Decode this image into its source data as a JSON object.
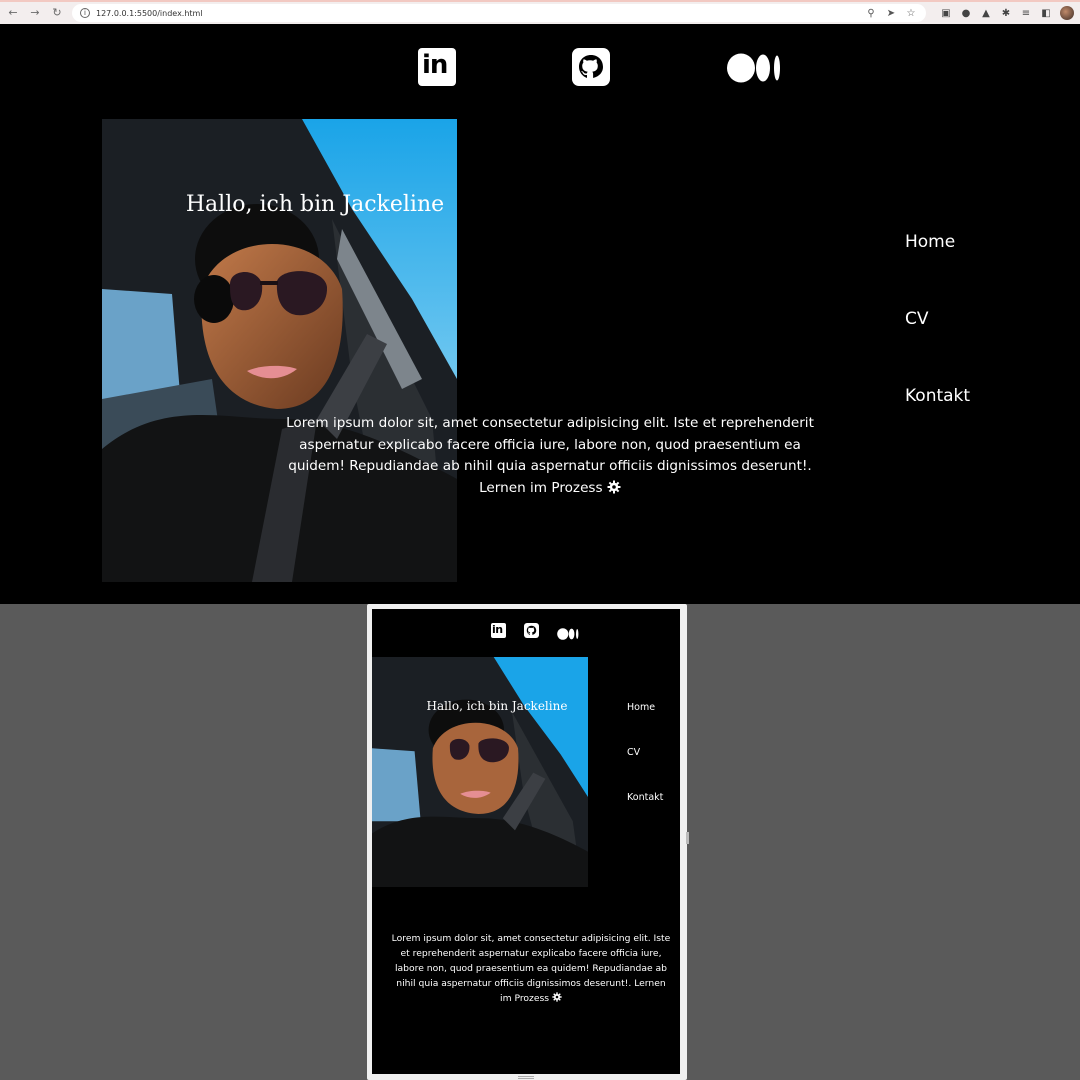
{
  "browser": {
    "url": "127.0.0.1:5500/index.html",
    "back_icon": "arrow-left-icon",
    "forward_icon": "arrow-right-icon",
    "reload_icon": "reload-icon"
  },
  "social_links": {
    "linkedin_text": "in",
    "github_icon": "github-icon",
    "medium_icon": "medium-icon"
  },
  "hero": {
    "greeting": "Hallo, ich bin Jackeline",
    "intro_text": "Lorem ipsum dolor sit, amet consectetur adipisicing elit. Iste et reprehenderit aspernatur explicabo facere officia iure, labore non, quod praesentium ea quidem! Repudiandae ab nihil quia aspernatur officiis dignissimos deserunt!. Lernen im Prozess",
    "gear_icon": "gear-icon"
  },
  "nav": {
    "items": [
      {
        "label": "Home"
      },
      {
        "label": "CV"
      },
      {
        "label": "Kontakt"
      }
    ]
  },
  "colors": {
    "page_background": "#000000",
    "text": "#ffffff",
    "devtools_background": "#5a5a5a"
  }
}
